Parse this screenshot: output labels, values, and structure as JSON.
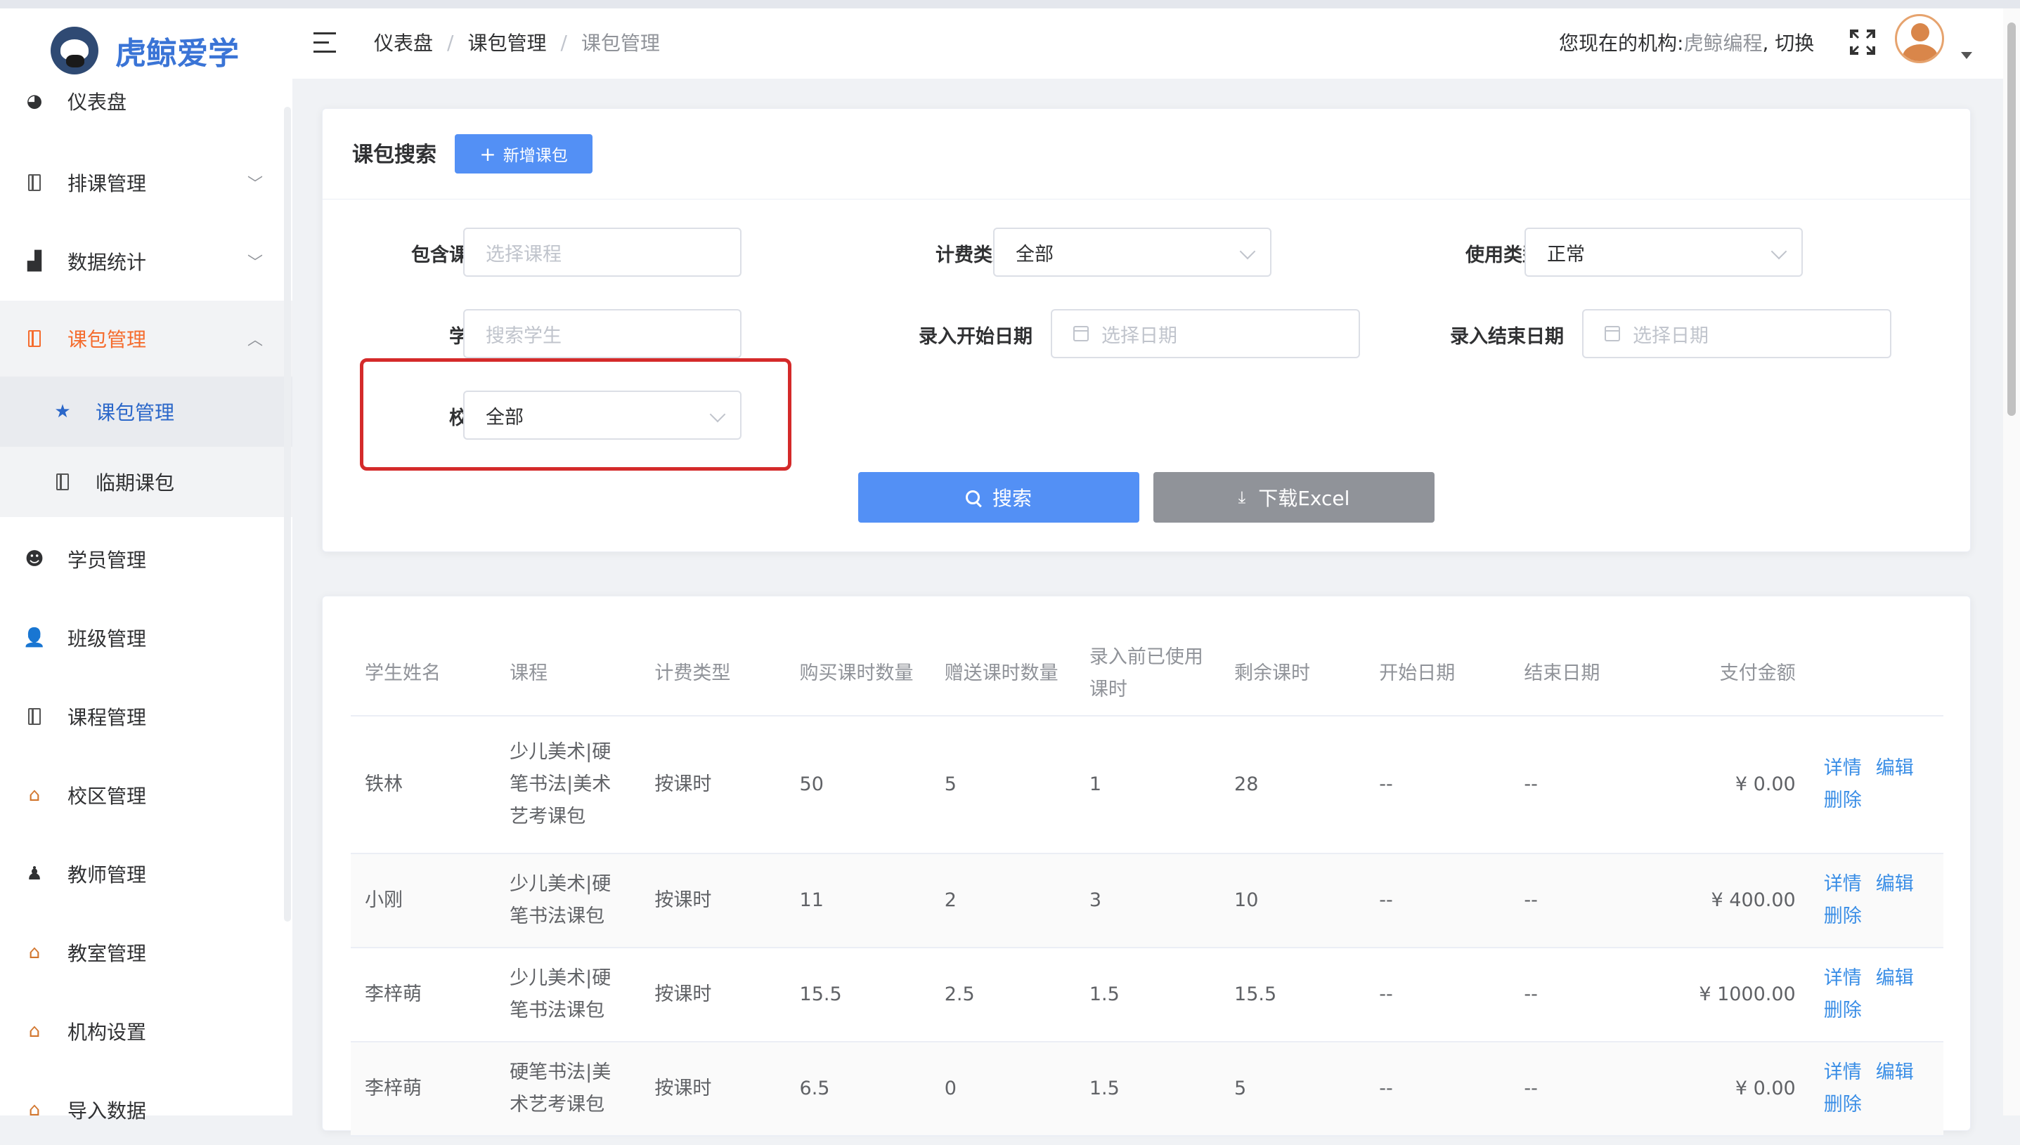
{
  "app": {
    "name": "虎鲸爱学"
  },
  "sidebar": {
    "items": [
      {
        "label": "仪表盘",
        "icon": "dashboard-icon"
      },
      {
        "label": "排课管理",
        "icon": "book-icon"
      },
      {
        "label": "数据统计",
        "icon": "bar-chart-icon"
      },
      {
        "label": "课包管理",
        "icon": "book-icon"
      },
      {
        "label": "课包管理",
        "icon": "star-icon"
      },
      {
        "label": "临期课包",
        "icon": "book-icon"
      },
      {
        "label": "学员管理",
        "icon": "student-icon"
      },
      {
        "label": "班级管理",
        "icon": "class-icon"
      },
      {
        "label": "课程管理",
        "icon": "book-icon"
      },
      {
        "label": "校区管理",
        "icon": "school-icon"
      },
      {
        "label": "教师管理",
        "icon": "teacher-icon"
      },
      {
        "label": "教室管理",
        "icon": "school-icon"
      },
      {
        "label": "机构设置",
        "icon": "school-icon"
      },
      {
        "label": "导入数据",
        "icon": "school-icon"
      }
    ]
  },
  "header": {
    "breadcrumb": [
      "仪表盘",
      "课包管理",
      "课包管理"
    ],
    "breadcrumb_sep": "/",
    "org_prefix": "您现在的机构: ",
    "org_name": "虎鲸编程",
    "switch_label": ", 切换"
  },
  "search": {
    "title": "课包搜索",
    "add_button": "新增课包",
    "fields": {
      "course": {
        "label": "包含课程",
        "placeholder": "选择课程"
      },
      "billing_type": {
        "label": "计费类型",
        "value": "全部"
      },
      "usage_type": {
        "label": "使用类型",
        "value": "正常"
      },
      "student": {
        "label": "学生",
        "placeholder": "搜索学生"
      },
      "start_date": {
        "label": "录入开始日期",
        "placeholder": "选择日期"
      },
      "end_date": {
        "label": "录入结束日期",
        "placeholder": "选择日期"
      },
      "campus": {
        "label": "校区",
        "value": "全部"
      }
    },
    "search_button": "搜索",
    "excel_button": "下载Excel"
  },
  "table": {
    "columns": [
      "学生姓名",
      "课程",
      "计费类型",
      "购买课时数量",
      "赠送课时数量",
      "录入前已使用课时",
      "剩余课时",
      "开始日期",
      "结束日期",
      "支付金额"
    ],
    "ops": {
      "detail": "详情",
      "edit": "编辑",
      "delete": "删除"
    },
    "rows": [
      [
        "铁林",
        "少儿美术|硬笔书法|美术艺考课包",
        "按课时",
        "50",
        "5",
        "1",
        "28",
        "--",
        "--",
        "¥ 0.00"
      ],
      [
        "小刚",
        "少儿美术|硬笔书法课包",
        "按课时",
        "11",
        "2",
        "3",
        "10",
        "--",
        "--",
        "¥ 400.00"
      ],
      [
        "李梓萌",
        "少儿美术|硬笔书法课包",
        "按课时",
        "15.5",
        "2.5",
        "1.5",
        "15.5",
        "--",
        "--",
        "¥ 1000.00"
      ],
      [
        "李梓萌",
        "硬笔书法|美术艺考课包",
        "按课时",
        "6.5",
        "0",
        "1.5",
        "5",
        "--",
        "--",
        "¥ 0.00"
      ]
    ]
  },
  "colors": {
    "accent": "#5390f5",
    "active_menu": "#f56c2e",
    "highlight": "#d42a2a",
    "link": "#3a8ee6"
  }
}
